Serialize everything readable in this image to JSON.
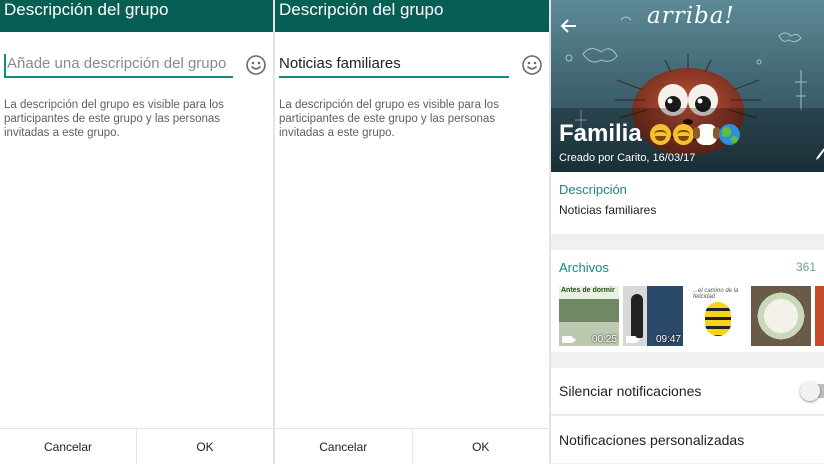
{
  "screen_left": {
    "title": "Descripción del grupo",
    "description_input": {
      "value": "",
      "placeholder": "Añade una descripción del grupo"
    },
    "emoji_icon": "smiley-face-icon",
    "hint": "La descripción del grupo es visible para los participantes de este grupo y las personas invitadas a este grupo.",
    "cancel_label": "Cancelar",
    "ok_label": "OK"
  },
  "screen_middle": {
    "title": "Descripción del grupo",
    "description_input": {
      "value": "Noticias familiares",
      "placeholder": ""
    },
    "emoji_icon": "smiley-face-icon",
    "hint": "La descripción del grupo es visible para los participantes de este grupo y las personas invitadas a este grupo.",
    "cancel_label": "Cancelar",
    "ok_label": "OK"
  },
  "screen_right": {
    "back_icon": "arrow-left-icon",
    "header_art_text": "arriba!",
    "group_name": "Familia",
    "group_emojis": [
      "smiling-face-icon",
      "smiling-face-icon",
      "dog-face-icon",
      "globe-icon"
    ],
    "created_by": "Creado por Carito, 16/03/17",
    "description": {
      "title": "Descripción",
      "text": "Noticias familiares"
    },
    "files": {
      "title": "Archivos",
      "count": "361",
      "thumbnails": [
        {
          "kind": "video",
          "caption": "Antes de dormir",
          "duration": "00:25"
        },
        {
          "kind": "video",
          "caption": "",
          "duration": "09:47"
        },
        {
          "kind": "image",
          "caption": "...el camino de la felicidad"
        },
        {
          "kind": "image",
          "caption": ""
        },
        {
          "kind": "image",
          "caption": ""
        }
      ]
    },
    "mute_row": {
      "label": "Silenciar notificaciones",
      "enabled": false
    },
    "custom_row": {
      "label": "Notificaciones personalizadas"
    }
  },
  "colors": {
    "header_green": "#075e54",
    "accent_teal": "#128c7e",
    "section_background": "#f0f0f0"
  }
}
